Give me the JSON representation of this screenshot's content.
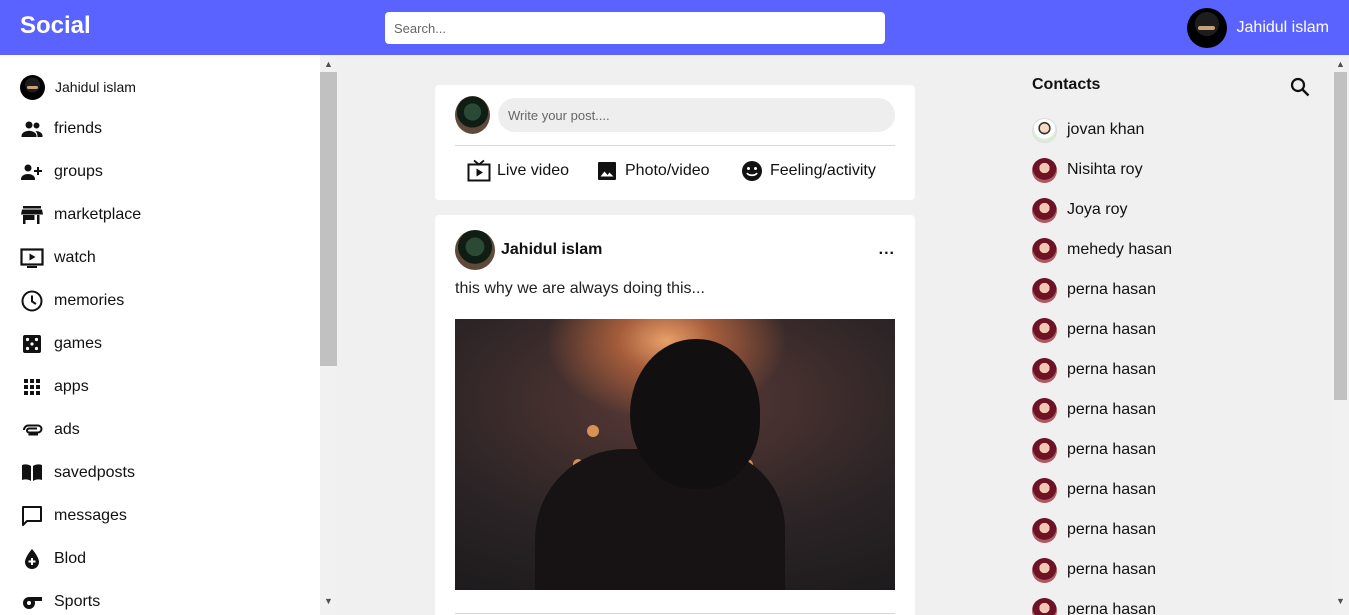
{
  "header": {
    "brand": "Social",
    "search_placeholder": "Search...",
    "user_name": "Jahidul islam"
  },
  "sidebar": {
    "profile_name": "Jahidul islam",
    "items": [
      {
        "label": "friends",
        "icon": "people-icon"
      },
      {
        "label": "groups",
        "icon": "group-add-icon"
      },
      {
        "label": "marketplace",
        "icon": "store-icon"
      },
      {
        "label": "watch",
        "icon": "tv-play-icon"
      },
      {
        "label": "memories",
        "icon": "clock-icon"
      },
      {
        "label": "games",
        "icon": "dice-icon"
      },
      {
        "label": "apps",
        "icon": "apps-grid-icon"
      },
      {
        "label": "ads",
        "icon": "paperclip-icon"
      },
      {
        "label": "savedposts",
        "icon": "book-icon"
      },
      {
        "label": "messages",
        "icon": "chat-icon"
      },
      {
        "label": "Blod",
        "icon": "blood-drop-icon"
      },
      {
        "label": "Sports",
        "icon": "whistle-icon"
      }
    ]
  },
  "composer": {
    "placeholder": "Write your post....",
    "options": [
      {
        "label": "Live video",
        "icon": "live-tv-icon"
      },
      {
        "label": "Photo/video",
        "icon": "image-icon"
      },
      {
        "label": "Feeling/activity",
        "icon": "smiley-icon"
      }
    ]
  },
  "post": {
    "author": "Jahidul islam",
    "more": "...",
    "text": "this why we are always doing this..."
  },
  "contacts": {
    "title": "Contacts",
    "list": [
      {
        "name": "jovan khan",
        "avatar": "cartoon"
      },
      {
        "name": "Nisihta roy",
        "avatar": "red"
      },
      {
        "name": "Joya roy",
        "avatar": "red"
      },
      {
        "name": "mehedy hasan",
        "avatar": "red"
      },
      {
        "name": "perna hasan",
        "avatar": "red"
      },
      {
        "name": "perna hasan",
        "avatar": "red"
      },
      {
        "name": "perna hasan",
        "avatar": "red"
      },
      {
        "name": "perna hasan",
        "avatar": "red"
      },
      {
        "name": "perna hasan",
        "avatar": "red"
      },
      {
        "name": "perna hasan",
        "avatar": "red"
      },
      {
        "name": "perna hasan",
        "avatar": "red"
      },
      {
        "name": "perna hasan",
        "avatar": "red"
      },
      {
        "name": "perna hasan",
        "avatar": "red"
      }
    ]
  },
  "colors": {
    "topbar": "#5a63ff",
    "background": "#f0f0f0"
  }
}
